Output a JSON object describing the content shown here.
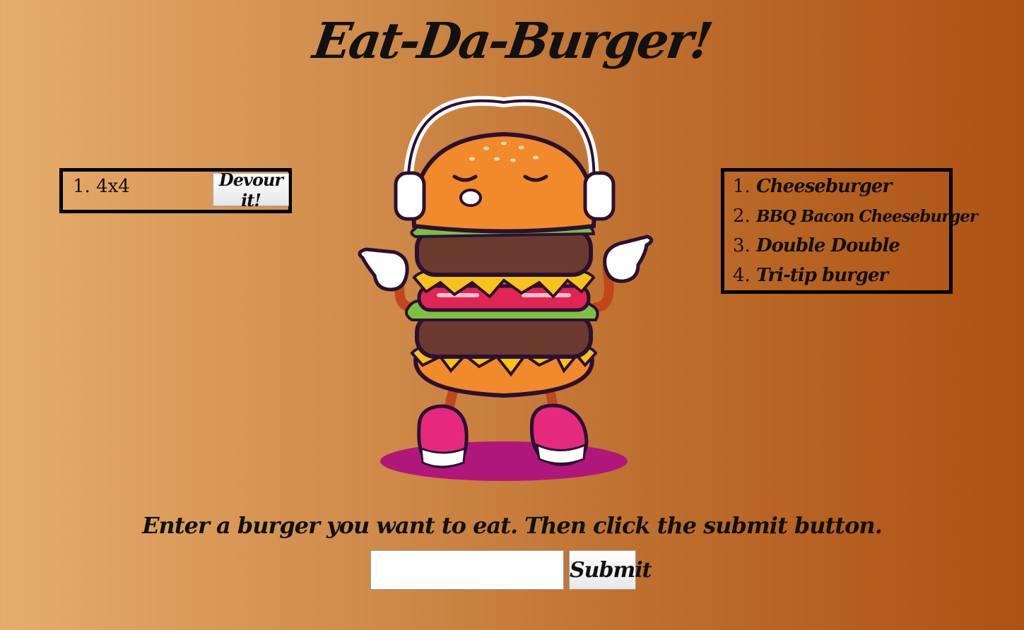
{
  "header": {
    "title": "Eat-Da-Burger!"
  },
  "devoured": {
    "items": [
      {
        "number": "1.",
        "name": "4x4",
        "button_label": "Devour it!"
      }
    ]
  },
  "eaten": {
    "items": [
      {
        "number": "1.",
        "name": "Cheeseburger"
      },
      {
        "number": "2.",
        "name": "BBQ Bacon Cheeseburger"
      },
      {
        "number": "3.",
        "name": "Double Double"
      },
      {
        "number": "4.",
        "name": "Tri-tip burger"
      }
    ]
  },
  "form": {
    "prompt": "Enter a burger you want to eat. Then click the submit button.",
    "input_value": "",
    "input_placeholder": "",
    "submit_label": "Submit"
  },
  "colors": {
    "gradient_left": "#e6ad6b",
    "gradient_right": "#ad5213",
    "border": "#000000",
    "bun": "#f08a2b",
    "patty": "#6b3a2e",
    "cheese": "#f6c21b",
    "shadow": "#b0177a"
  },
  "icons": {
    "mascot": "burger-mascot-illustration"
  }
}
